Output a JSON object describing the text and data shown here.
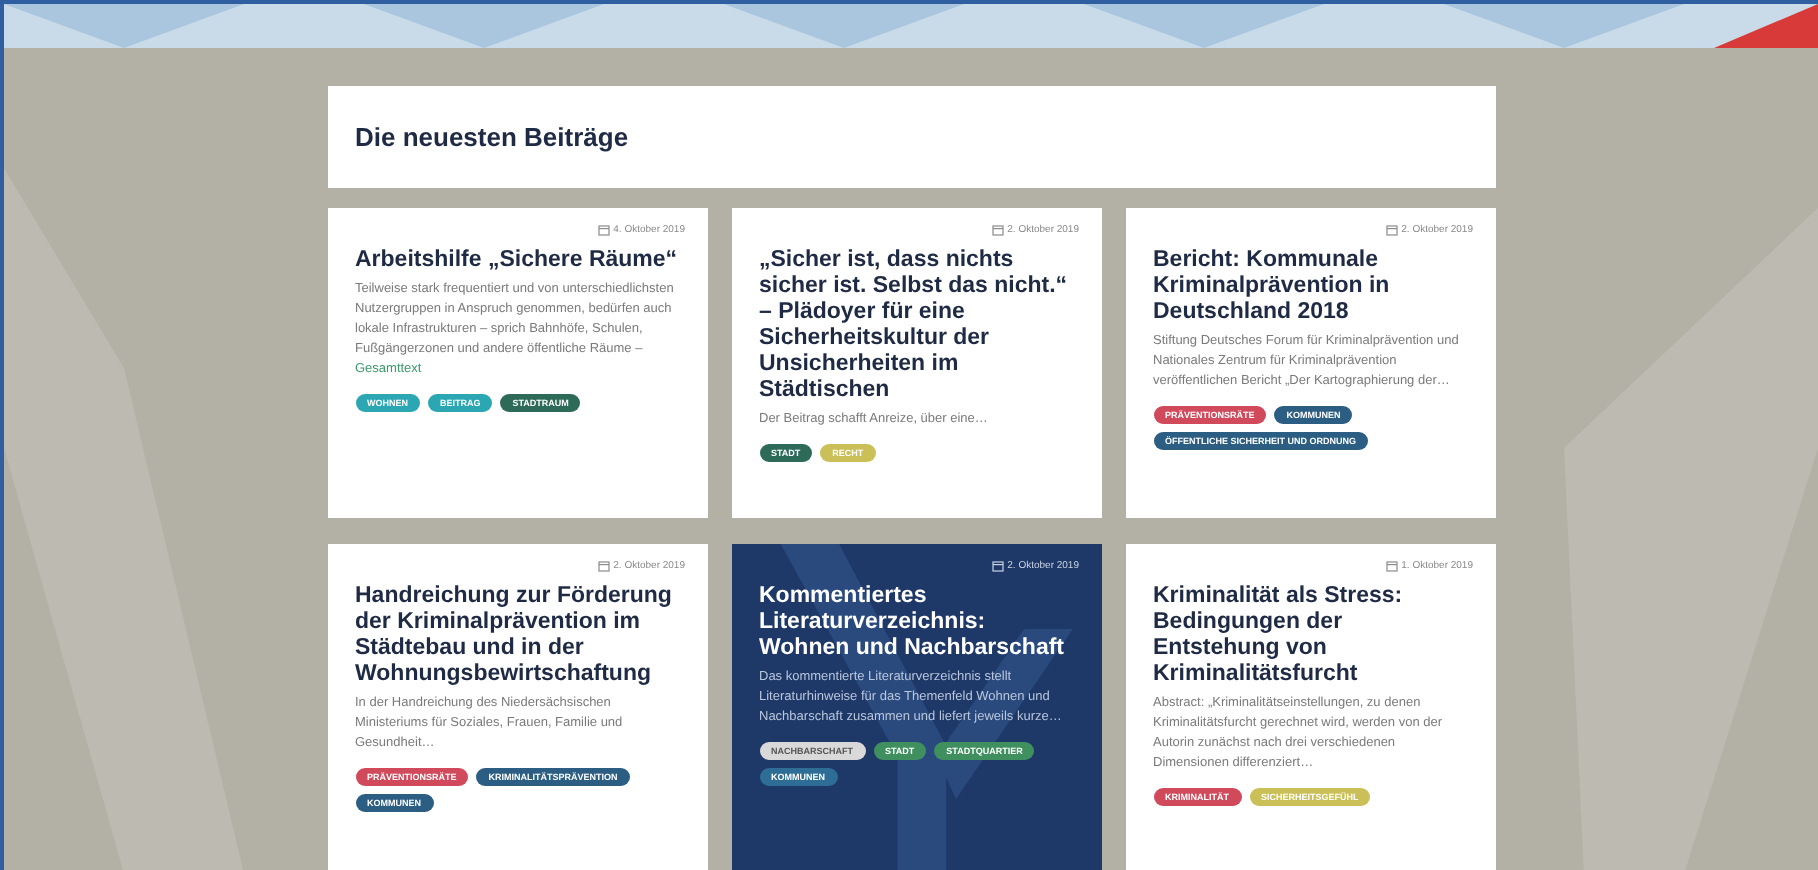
{
  "section": {
    "title": "Die neuesten Beiträge"
  },
  "cards": [
    {
      "kind": "standard",
      "date": "4. Oktober 2019",
      "title": "Arbeitshilfe „Sichere Räume“",
      "text": "Teilweise stark frequentiert und von unterschiedlichsten Nutzergruppen in Anspruch genommen, bedürfen auch lokale Infrastrukturen – sprich Bahnhöfe, Schulen, Fußgängerzonen und andere öffentliche Räume –",
      "more": "Gesamttext",
      "tags": [
        {
          "label": "WOHNEN",
          "color": "#2ba7b4"
        },
        {
          "label": "BEITRAG",
          "color": "#2ba7b4"
        },
        {
          "label": "STADTRAUM",
          "color": "#2d6b58"
        }
      ]
    },
    {
      "kind": "standard",
      "date": "2. Oktober 2019",
      "title": "„Sicher ist, dass nichts sicher ist. Selbst das nicht.“ – Plädoyer für eine Sicherheitskultur der Unsicherheiten im Städtischen",
      "text": "Der Beitrag schafft Anreize, über eine…",
      "tags": [
        {
          "label": "STADT",
          "color": "#2d6b58"
        },
        {
          "label": "RECHT",
          "color": "#cbbf58"
        }
      ]
    },
    {
      "kind": "standard",
      "date": "2. Oktober 2019",
      "title": "Bericht: Kommunale Kriminalprävention in Deutschland 2018",
      "text": "Stiftung Deutsches Forum für Kriminalprävention und Nationales Zentrum für Kriminalprävention veröffentlichen Bericht „Der Kartographierung der…",
      "tags": [
        {
          "label": "PRÄVENTIONSRÄTE",
          "color": "#d04a5c"
        },
        {
          "label": "KOMMUNEN",
          "color": "#2c5e84"
        },
        {
          "label": "ÖFFENTLICHE SICHERHEIT UND ORDNUNG",
          "color": "#2c5e84"
        }
      ]
    },
    {
      "kind": "standard",
      "date": "2. Oktober 2019",
      "title": "Handreichung zur Förderung der Kriminalprävention im Städtebau und in der Wohnungsbewirtschaftung",
      "text": "In der Handreichung des Niedersächsischen Ministeriums für Soziales, Frauen, Familie und Gesundheit…",
      "tags": [
        {
          "label": "PRÄVENTIONSRÄTE",
          "color": "#d04a5c"
        },
        {
          "label": "KRIMINALITÄTSPRÄVENTION",
          "color": "#2c5e84"
        },
        {
          "label": "KOMMUNEN",
          "color": "#2c5e84"
        }
      ]
    },
    {
      "kind": "featured",
      "date": "2. Oktober 2019",
      "title": "Kommentiertes Literaturverzeichnis: Wohnen und Nachbarschaft",
      "text": "Das kommentierte Literaturverzeichnis stellt Literaturhinweise für das Themenfeld Wohnen und Nachbarschaft zusammen und liefert jeweils kurze…",
      "tags": [
        {
          "label": "NACHBARSCHAFT",
          "color": "#d9d9d9"
        },
        {
          "label": "STADT",
          "color": "#3f8f5f"
        },
        {
          "label": "STADTQUARTIER",
          "color": "#3f8f5f"
        },
        {
          "label": "KOMMUNEN",
          "color": "#2e6d96"
        }
      ]
    },
    {
      "kind": "standard",
      "date": "1. Oktober 2019",
      "title": "Kriminalität als Stress: Bedingungen der Entstehung von Kriminalitätsfurcht",
      "text": "Abstract: „Kriminalitätseinstellungen, zu denen Kriminalitätsfurcht gerechnet wird, werden von der Autorin zunächst nach drei verschiedenen Dimensionen differenziert…",
      "tags": [
        {
          "label": "KRIMINALITÄT",
          "color": "#d04a5c"
        },
        {
          "label": "SICHERHEITSGEFÜHL",
          "color": "#cbbf58"
        }
      ]
    }
  ]
}
